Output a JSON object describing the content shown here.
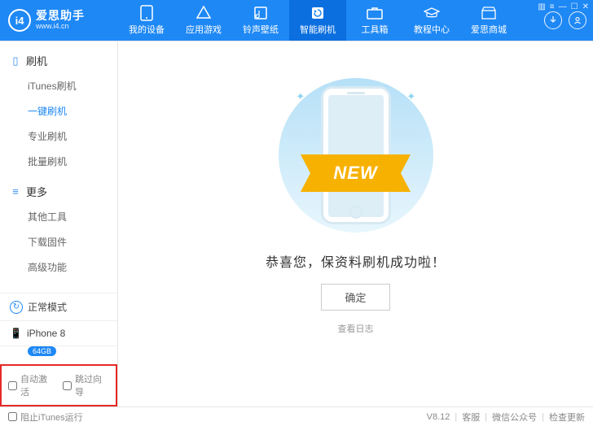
{
  "brand": {
    "title": "爱思助手",
    "url": "www.i4.cn",
    "logo_text": "i4"
  },
  "header_tabs": [
    {
      "label": "我的设备",
      "icon": "device"
    },
    {
      "label": "应用游戏",
      "icon": "apps"
    },
    {
      "label": "铃声壁纸",
      "icon": "ringtone"
    },
    {
      "label": "智能刷机",
      "icon": "flash"
    },
    {
      "label": "工具箱",
      "icon": "toolbox"
    },
    {
      "label": "教程中心",
      "icon": "tutorial"
    },
    {
      "label": "爱思商城",
      "icon": "store"
    }
  ],
  "active_header_tab": 3,
  "sidebar": {
    "section_flash": {
      "title": "刷机"
    },
    "flash_items": [
      "iTunes刷机",
      "一键刷机",
      "专业刷机",
      "批量刷机"
    ],
    "flash_active_index": 1,
    "section_more": {
      "title": "更多"
    },
    "more_items": [
      "其他工具",
      "下载固件",
      "高级功能"
    ]
  },
  "mode": {
    "label": "正常模式"
  },
  "device": {
    "name": "iPhone 8",
    "capacity": "64GB"
  },
  "bottom_checks": {
    "auto_activate": "自动激活",
    "skip_guide": "跳过向导"
  },
  "main": {
    "ribbon": "NEW",
    "message": "恭喜您，保资料刷机成功啦！",
    "ok": "确定",
    "log": "查看日志"
  },
  "footer": {
    "block_itunes": "阻止iTunes运行",
    "version": "V8.12",
    "support": "客服",
    "wechat": "微信公众号",
    "update": "检查更新"
  }
}
